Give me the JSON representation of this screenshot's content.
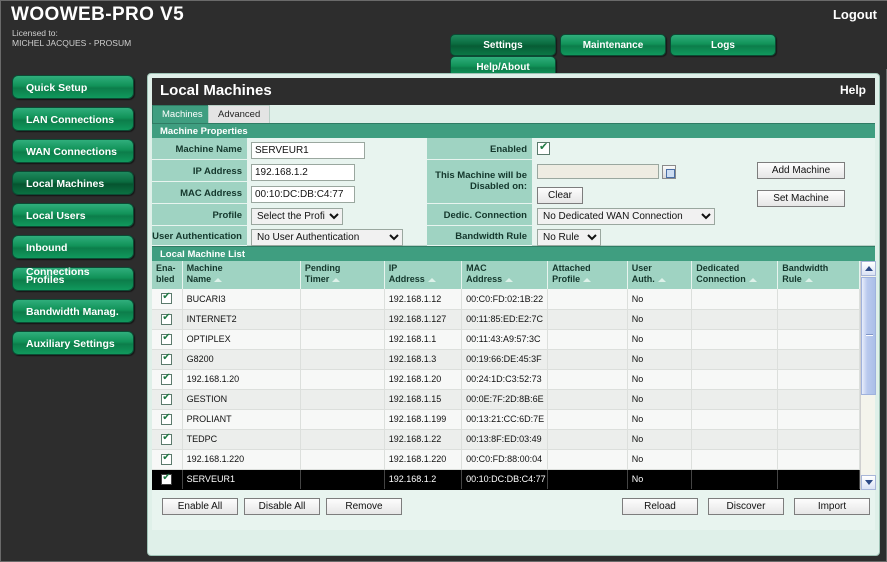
{
  "topbar": {
    "brand": "WOOWEB-PRO V5",
    "licensed_label": "Licensed to:",
    "licensee": "MICHEL JACQUES - PROSUM",
    "logout": "Logout",
    "nav": [
      {
        "label": "Settings",
        "active": true
      },
      {
        "label": "Maintenance",
        "active": false
      },
      {
        "label": "Logs",
        "active": false
      },
      {
        "label": "Help/About",
        "active": false
      }
    ]
  },
  "sidebar": {
    "items": [
      {
        "label": "Quick Setup",
        "active": false
      },
      {
        "label": "LAN Connections",
        "active": false
      },
      {
        "label": "WAN Connections",
        "active": false
      },
      {
        "label": "Local Machines",
        "active": true
      },
      {
        "label": "Local Users",
        "active": false
      },
      {
        "label": "Inbound Connections",
        "active": false
      },
      {
        "label": "Profiles",
        "active": false
      },
      {
        "label": "Bandwidth Manag.",
        "active": false
      },
      {
        "label": "Auxiliary Settings",
        "active": false
      }
    ]
  },
  "panel": {
    "title": "Local Machines",
    "help": "Help",
    "tabs": [
      {
        "label": "Machines",
        "active": true
      },
      {
        "label": "Advanced",
        "active": false
      }
    ],
    "properties_section_title": "Machine Properties",
    "list_section_title": "Local Machine List"
  },
  "form": {
    "machine_name_label": "Machine Name",
    "machine_name_value": "SERVEUR1",
    "ip_address_label": "IP Address",
    "ip_address_value": "192.168.1.2",
    "mac_address_label": "MAC Address",
    "mac_address_value": "00:10:DC:DB:C4:77",
    "profile_label": "Profile",
    "profile_value": "Select the Profile",
    "user_auth_label": "User Authentication",
    "user_auth_value": "No User Authentication",
    "enabled_label": "Enabled",
    "enabled_checked": true,
    "disabled_on_label": "This Machine will be Disabled on:",
    "disabled_on_value": "",
    "clear_label": "Clear",
    "dedic_connection_label": "Dedic. Connection",
    "dedic_connection_value": "No Dedicated WAN Connection",
    "bandwidth_rule_label": "Bandwidth Rule",
    "bandwidth_rule_value": "No Rule",
    "add_machine_label": "Add Machine",
    "set_machine_label": "Set Machine"
  },
  "table": {
    "columns": [
      "Ena-\nbled",
      "Machine\nName",
      "Pending\nTimer",
      "IP\nAddress",
      "MAC\nAddress",
      "Attached\nProfile",
      "User\nAuth.",
      "Dedicated\nConnection",
      "Bandwidth\nRule"
    ],
    "rows": [
      {
        "enabled": true,
        "name": "BUCARI3",
        "timer": "",
        "ip": "192.168.1.12",
        "mac": "00:C0:FD:02:1B:22",
        "profile": "",
        "auth": "No",
        "dedicated": "",
        "rule": "",
        "selected": false
      },
      {
        "enabled": true,
        "name": "INTERNET2",
        "timer": "",
        "ip": "192.168.1.127",
        "mac": "00:11:85:ED:E2:7C",
        "profile": "",
        "auth": "No",
        "dedicated": "",
        "rule": "",
        "selected": false
      },
      {
        "enabled": true,
        "name": "OPTIPLEX",
        "timer": "",
        "ip": "192.168.1.1",
        "mac": "00:11:43:A9:57:3C",
        "profile": "",
        "auth": "No",
        "dedicated": "",
        "rule": "",
        "selected": false
      },
      {
        "enabled": true,
        "name": "G8200",
        "timer": "",
        "ip": "192.168.1.3",
        "mac": "00:19:66:DE:45:3F",
        "profile": "",
        "auth": "No",
        "dedicated": "",
        "rule": "",
        "selected": false
      },
      {
        "enabled": true,
        "name": "192.168.1.20",
        "timer": "",
        "ip": "192.168.1.20",
        "mac": "00:24:1D:C3:52:73",
        "profile": "",
        "auth": "No",
        "dedicated": "",
        "rule": "",
        "selected": false
      },
      {
        "enabled": true,
        "name": "GESTION",
        "timer": "",
        "ip": "192.168.1.15",
        "mac": "00:0E:7F:2D:8B:6E",
        "profile": "",
        "auth": "No",
        "dedicated": "",
        "rule": "",
        "selected": false
      },
      {
        "enabled": true,
        "name": "PROLIANT",
        "timer": "",
        "ip": "192.168.1.199",
        "mac": "00:13:21:CC:6D:7E",
        "profile": "",
        "auth": "No",
        "dedicated": "",
        "rule": "",
        "selected": false
      },
      {
        "enabled": true,
        "name": "TEDPC",
        "timer": "",
        "ip": "192.168.1.22",
        "mac": "00:13:8F:ED:03:49",
        "profile": "",
        "auth": "No",
        "dedicated": "",
        "rule": "",
        "selected": false
      },
      {
        "enabled": true,
        "name": "192.168.1.220",
        "timer": "",
        "ip": "192.168.1.220",
        "mac": "00:C0:FD:88:00:04",
        "profile": "",
        "auth": "No",
        "dedicated": "",
        "rule": "",
        "selected": false
      },
      {
        "enabled": true,
        "name": "SERVEUR1",
        "timer": "",
        "ip": "192.168.1.2",
        "mac": "00:10:DC:DB:C4:77",
        "profile": "",
        "auth": "No",
        "dedicated": "",
        "rule": "",
        "selected": true
      }
    ]
  },
  "footer": {
    "enable_all": "Enable All",
    "disable_all": "Disable All",
    "remove": "Remove",
    "reload": "Reload",
    "discover": "Discover",
    "import": "Import"
  },
  "colors": {
    "brand_green": "#119258",
    "section_green": "#3f9e80",
    "label_green": "#9fd3c2",
    "panel_bg": "#dff0e9",
    "dark": "#2d2d2d",
    "selected_row": "#000000"
  }
}
